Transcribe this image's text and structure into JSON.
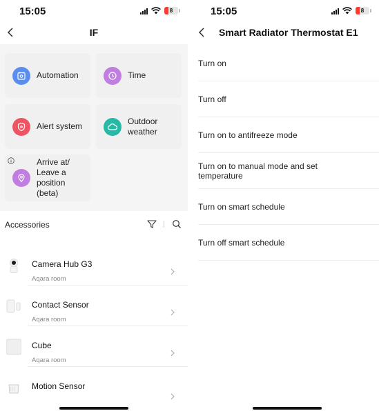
{
  "left": {
    "status": {
      "time": "15:05",
      "battery": "8"
    },
    "title": "IF",
    "cards": [
      {
        "label": "Automation",
        "color": "#5b8def"
      },
      {
        "label": "Time",
        "color": "#c07ee0"
      },
      {
        "label": "Alert system",
        "color": "#ee5563"
      },
      {
        "label_line1": "Outdoor",
        "label_line2": "weather",
        "color": "#25b9a6"
      },
      {
        "label_lines": [
          "Arrive at/",
          "Leave a",
          "position",
          "(beta)"
        ],
        "color": "#c07ee0"
      }
    ],
    "accessories": {
      "title": "Accessories",
      "items": [
        {
          "name": "Camera Hub G3",
          "room": "Aqara room"
        },
        {
          "name": "Contact Sensor",
          "room": "Aqara room"
        },
        {
          "name": "Cube",
          "room": "Aqara room"
        },
        {
          "name": "Motion Sensor",
          "room": ""
        }
      ]
    }
  },
  "right": {
    "status": {
      "time": "15:05",
      "battery": "8"
    },
    "title": "Smart Radiator Thermostat E1",
    "actions": [
      {
        "label": "Turn on"
      },
      {
        "label": "Turn off"
      },
      {
        "label": "Turn on to antifreeze mode"
      },
      {
        "label_line1": "Turn on to manual mode and set",
        "label_line2": "temperature"
      },
      {
        "label": "Turn on smart schedule"
      },
      {
        "label": "Turn off smart schedule"
      }
    ]
  }
}
